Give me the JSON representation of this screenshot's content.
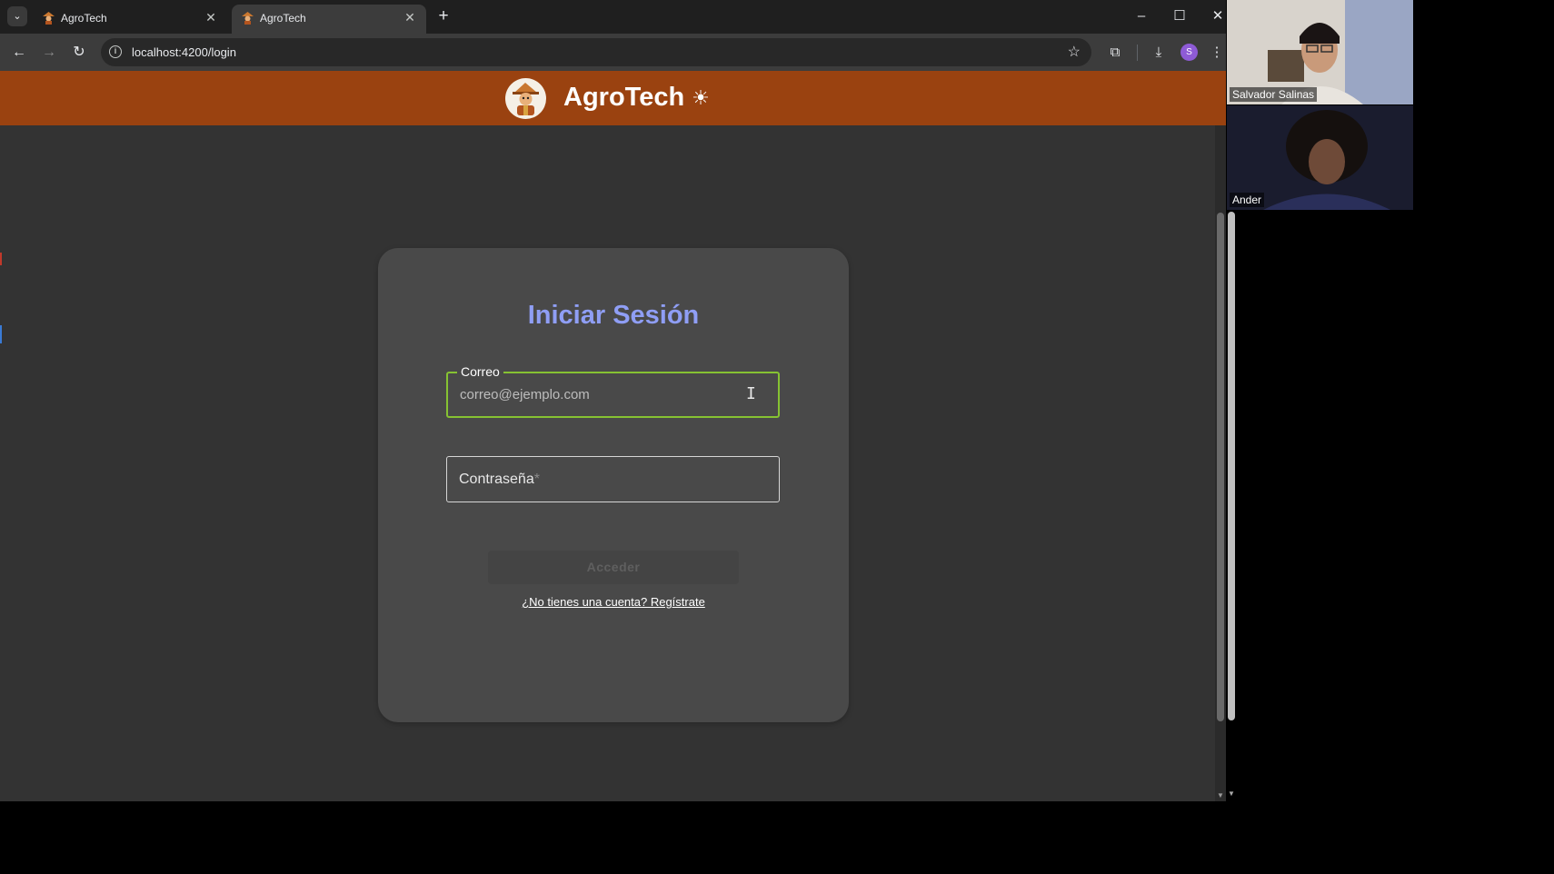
{
  "browser": {
    "tabs": [
      {
        "title": "AgroTech",
        "close": "✕",
        "favicon": "scarecrow-favicon"
      },
      {
        "title": "AgroTech",
        "close": "✕",
        "favicon": "scarecrow-favicon"
      }
    ],
    "tab_list_icon": "⌄",
    "new_tab": "+",
    "window": {
      "minimize": "–",
      "maximize": "☐",
      "close": "✕"
    },
    "nav": {
      "back": "←",
      "forward": "→",
      "reload": "↻"
    },
    "url": "localhost:4200/login",
    "bookmark_icon": "☆",
    "extensions_icon": "⧉",
    "download_icon": "⤓",
    "profile_initial": "S",
    "menu_icon": "⋮"
  },
  "app": {
    "title": "AgroTech",
    "theme_icon": "☀",
    "colors": {
      "header": "#9a4210",
      "title_accent": "#8f9ef5",
      "focus_border": "#86c232"
    }
  },
  "login": {
    "title": "Iniciar Sesión",
    "email": {
      "label": "Correo",
      "placeholder": "correo@ejemplo.com"
    },
    "password": {
      "label": "Contraseña",
      "required_mark": "*"
    },
    "submit_label": "Acceder",
    "register_link": "¿No tienes una cuenta? Regístrate"
  },
  "video_call": {
    "participants": [
      {
        "name": "Salvador Salinas"
      },
      {
        "name": "Ander"
      }
    ]
  }
}
